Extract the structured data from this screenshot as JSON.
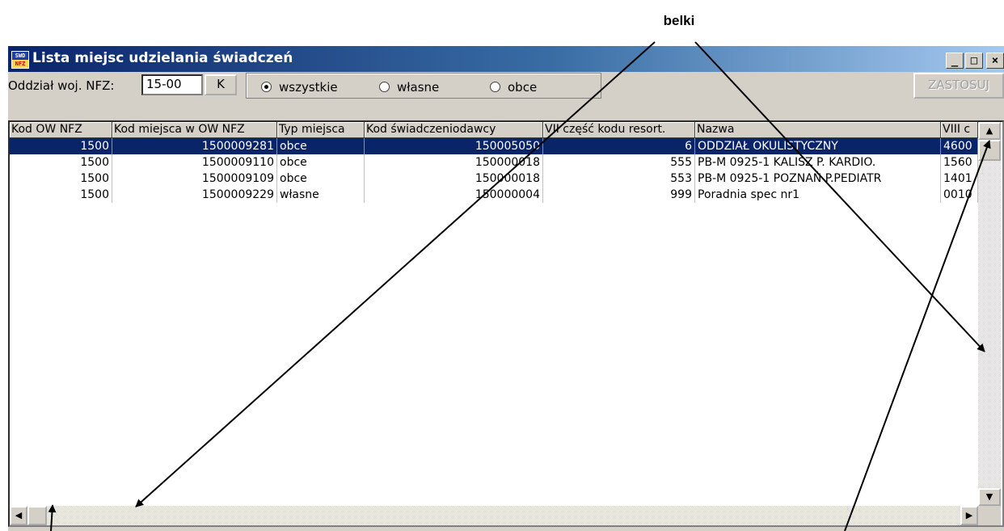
{
  "annotation": {
    "label": "belki"
  },
  "window": {
    "title": "Lista miejsc udzielania świadczeń",
    "icon_top": "SWD",
    "icon_bottom": "NFZ",
    "minimize_glyph": "_",
    "maximize_glyph": "□",
    "close_glyph": "×"
  },
  "toolbar": {
    "oddzial_label": "Oddział woj. NFZ:",
    "oddzial_value": "15-00",
    "k_button": "K",
    "radios": [
      {
        "label": "wszystkie",
        "checked": true
      },
      {
        "label": "własne",
        "checked": false
      },
      {
        "label": "obce",
        "checked": false
      }
    ],
    "apply_button": "ZASTOSUJ"
  },
  "table": {
    "columns": [
      "Kod OW NFZ",
      "Kod miejsca w OW NFZ",
      "Typ miejsca",
      "Kod świadczeniodawcy",
      "VII część kodu resort.",
      "Nazwa",
      "VIII c"
    ],
    "rows": [
      [
        "1500",
        "1500009281",
        "obce",
        "150005050",
        "6",
        "ODDZIAŁ OKULISTYCZNY",
        "4600"
      ],
      [
        "1500",
        "1500009110",
        "obce",
        "150000018",
        "555",
        "PB-M 0925-1 KALISZ P. KARDIO.",
        "1560"
      ],
      [
        "1500",
        "1500009109",
        "obce",
        "150000018",
        "553",
        "PB-M 0925-1 POZNAŃ P.PEDIATR",
        "1401"
      ],
      [
        "1500",
        "1500009229",
        "własne",
        "150000004",
        "999",
        "Poradnia spec nr1",
        "0010"
      ]
    ],
    "selected_row_index": 0
  },
  "scrollbars": {
    "up_arrow": "▲",
    "down_arrow": "▼",
    "left_arrow": "◀",
    "right_arrow": "▶"
  }
}
